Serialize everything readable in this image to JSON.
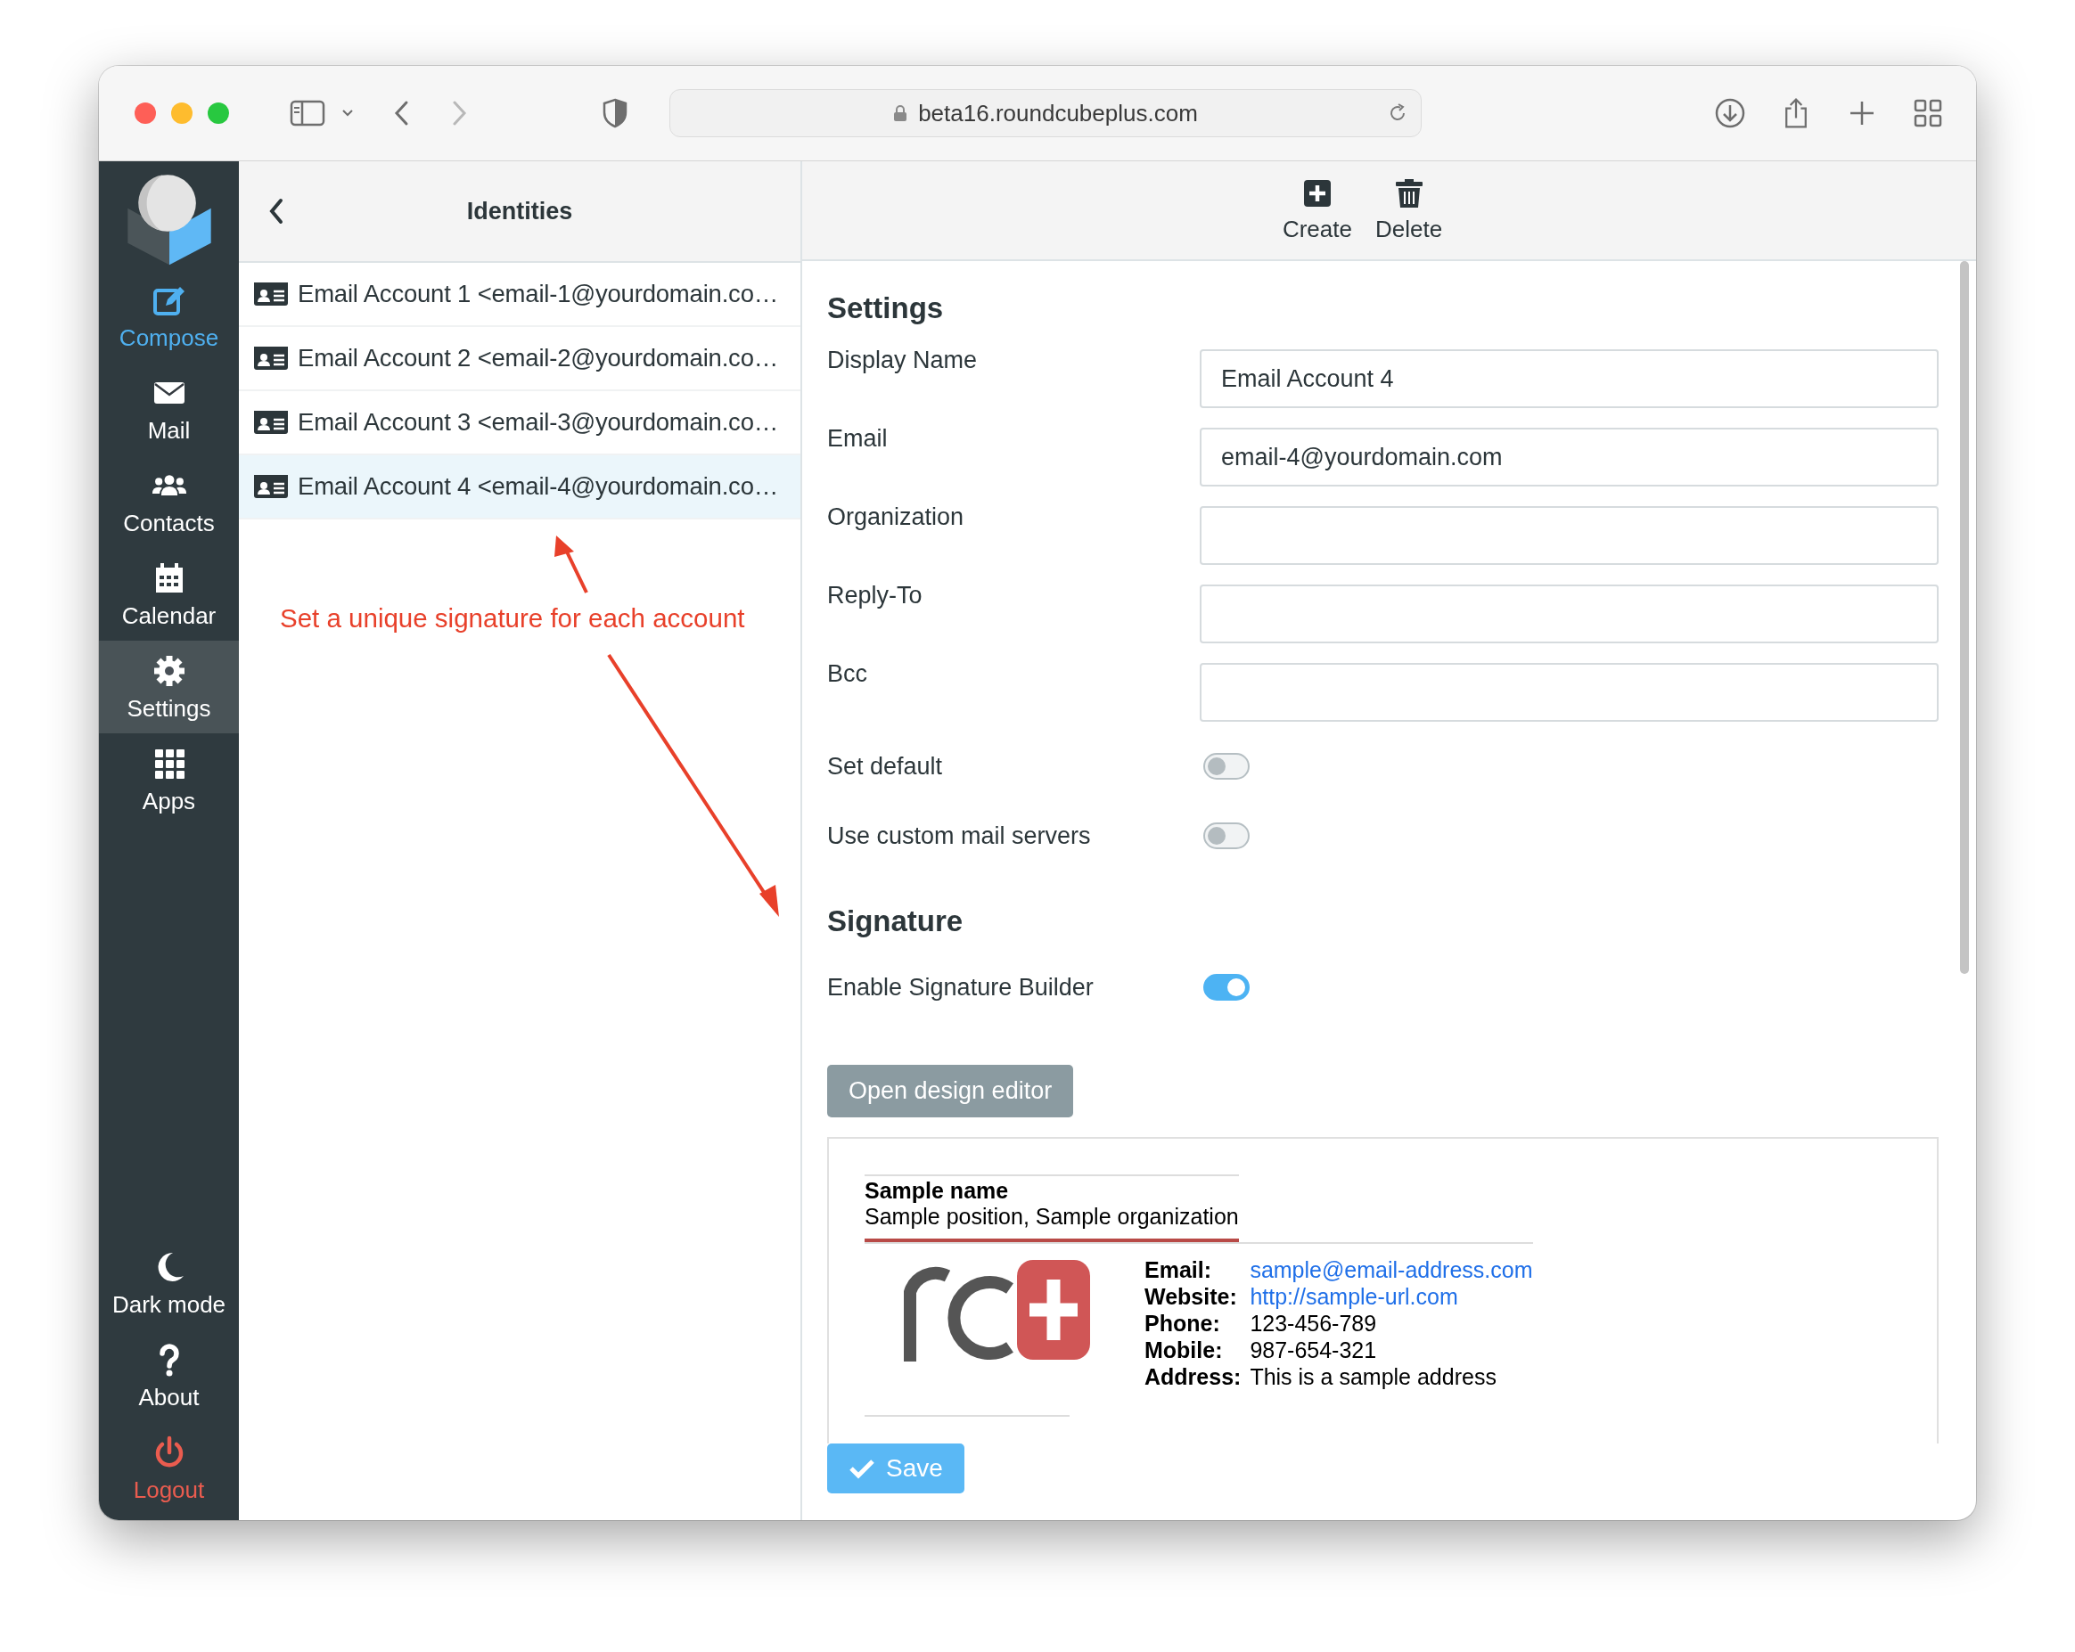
{
  "browser": {
    "url": "beta16.roundcubeplus.com"
  },
  "sidebar": {
    "items": [
      {
        "label": "Compose",
        "kind": "compose",
        "selected": false
      },
      {
        "label": "Mail",
        "kind": "nav",
        "selected": false
      },
      {
        "label": "Contacts",
        "kind": "nav",
        "selected": false
      },
      {
        "label": "Calendar",
        "kind": "nav",
        "selected": false
      },
      {
        "label": "Settings",
        "kind": "nav",
        "selected": true
      },
      {
        "label": "Apps",
        "kind": "nav",
        "selected": false
      }
    ],
    "bottom_items": [
      {
        "label": "Dark mode",
        "kind": "nav"
      },
      {
        "label": "About",
        "kind": "nav"
      },
      {
        "label": "Logout",
        "kind": "logout"
      }
    ]
  },
  "identities": {
    "title": "Identities",
    "items": [
      {
        "label": "Email Account 1 <email-1@yourdomain.co…",
        "selected": false
      },
      {
        "label": "Email Account 2 <email-2@yourdomain.co…",
        "selected": false
      },
      {
        "label": "Email Account 3 <email-3@yourdomain.co…",
        "selected": false
      },
      {
        "label": "Email Account 4 <email-4@yourdomain.co…",
        "selected": true
      }
    ]
  },
  "annotation": {
    "text": "Set a unique signature for each account"
  },
  "toolbar": {
    "buttons": [
      {
        "label": "Create",
        "kind": "create"
      },
      {
        "label": "Delete",
        "kind": "delete"
      }
    ]
  },
  "settings": {
    "heading": "Settings",
    "fields": [
      {
        "label": "Display Name",
        "kind": "text",
        "value": "Email Account 4"
      },
      {
        "label": "Email",
        "kind": "text",
        "value": "email-4@yourdomain.com"
      },
      {
        "label": "Organization",
        "kind": "text"
      },
      {
        "label": "Reply-To",
        "kind": "text"
      },
      {
        "label": "Bcc",
        "kind": "text"
      },
      {
        "label": "Set default",
        "kind": "toggle",
        "on": false
      },
      {
        "label": "Use custom mail servers",
        "kind": "toggle",
        "on": false
      }
    ]
  },
  "signature": {
    "heading": "Signature",
    "toggle": {
      "label": "Enable Signature Builder",
      "on": true
    },
    "button": "Open design editor",
    "preview": {
      "name": "Sample name",
      "position": "Sample position, Sample organization",
      "rows": [
        {
          "label": "Email:",
          "value": "sample@email-address.com",
          "kind": "link"
        },
        {
          "label": "Website:",
          "value": "http://sample-url.com",
          "kind": "link"
        },
        {
          "label": "Phone:",
          "value": "123-456-789",
          "kind": "text"
        },
        {
          "label": "Mobile:",
          "value": "987-654-321",
          "kind": "text"
        },
        {
          "label": "Address:",
          "value": "This is a sample address",
          "kind": "text"
        }
      ]
    }
  },
  "save": "Save"
}
